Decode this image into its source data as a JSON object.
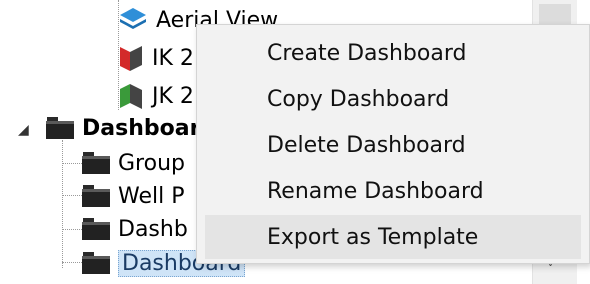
{
  "tree": {
    "items": [
      {
        "label": "Aerial View",
        "icon": "layers-icon"
      },
      {
        "label": "IK 2",
        "icon": "section-red-icon"
      },
      {
        "label": "JK 2",
        "icon": "section-green-icon"
      },
      {
        "label": "Dashboards",
        "icon": "folder-icon",
        "expander": "◢"
      },
      {
        "label": "Group",
        "icon": "folder-icon"
      },
      {
        "label": "Well P",
        "icon": "folder-icon"
      },
      {
        "label": "Dashb",
        "icon": "folder-icon"
      },
      {
        "label": "Dashboard",
        "icon": "folder-icon"
      }
    ]
  },
  "context_menu": {
    "items": [
      {
        "label": "Create Dashboard"
      },
      {
        "label": "Copy Dashboard"
      },
      {
        "label": "Delete Dashboard"
      },
      {
        "label": "Rename Dashboard"
      },
      {
        "label": "Export as Template"
      }
    ],
    "hovered": "Export as Template"
  },
  "scrollbar": {
    "down_arrow": "˅"
  },
  "colors": {
    "menu_bg": "#f2f2f2",
    "menu_hover": "#e4e4e4",
    "selection": "#cfe4f7"
  }
}
